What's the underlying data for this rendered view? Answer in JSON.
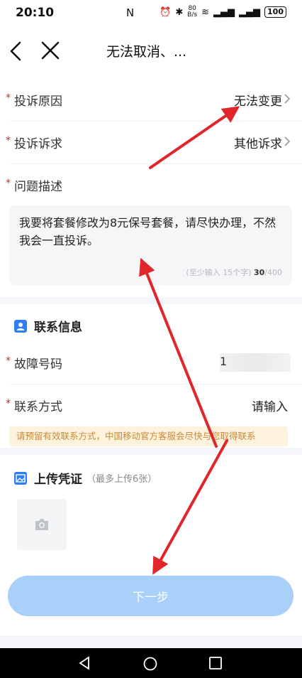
{
  "status_bar": {
    "time": "20:10",
    "nfc": "N",
    "net_speed_top": "80",
    "net_speed_bottom": "B/s",
    "battery": "100"
  },
  "nav": {
    "title": "无法取消、..."
  },
  "form": {
    "required_mark": "*",
    "reason": {
      "label": "投诉原因",
      "value": "无法变更"
    },
    "demand": {
      "label": "投诉诉求",
      "value": "其他诉求"
    },
    "description": {
      "label": "问题描述",
      "text": "我要将套餐修改为8元保号套餐，请尽快办理，不然我会一直投诉。",
      "hint": "(至少输入 15个字)",
      "count": "30",
      "max": "/400"
    }
  },
  "contact": {
    "title": "联系信息",
    "fault_number": {
      "label": "故障号码",
      "value_prefix": "1"
    },
    "contact_method": {
      "label": "联系方式",
      "placeholder": "请输入"
    },
    "notice": "请预留有效联系方式，中国移动官方客服会尽快与您取得联系"
  },
  "upload": {
    "title": "上传凭证",
    "subtitle": "（最多上传6张）"
  },
  "next_button": {
    "label": "下一步"
  },
  "colors": {
    "accent": "#2f7ff2",
    "button": "#a9d0f8",
    "required": "#e0252b",
    "annotation_arrow": "#e0252b"
  }
}
